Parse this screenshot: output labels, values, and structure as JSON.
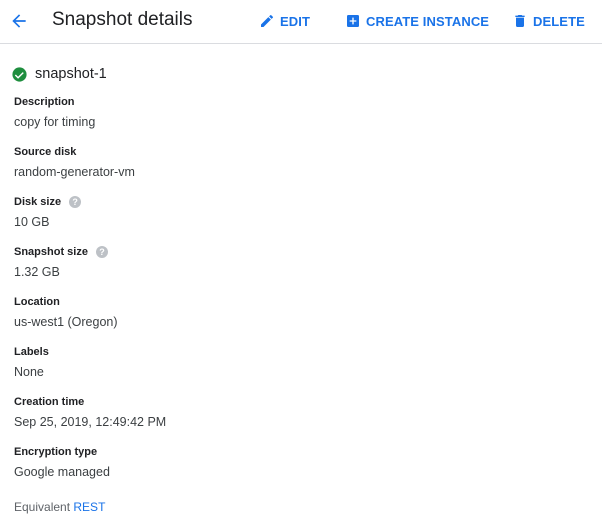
{
  "header": {
    "title": "Snapshot details",
    "actions": [
      {
        "label": "EDIT",
        "icon": "pencil-icon"
      },
      {
        "label": "CREATE INSTANCE",
        "icon": "add-box-icon"
      },
      {
        "label": "DELETE",
        "icon": "trash-icon"
      }
    ]
  },
  "snapshot": {
    "name": "snapshot-1",
    "status_icon": "check-circle-icon",
    "status_color": "#1e8e3e"
  },
  "fields": [
    {
      "label": "Description",
      "value": "copy for timing",
      "help": false
    },
    {
      "label": "Source disk",
      "value": "random-generator-vm",
      "help": false
    },
    {
      "label": "Disk size",
      "value": "10 GB",
      "help": true
    },
    {
      "label": "Snapshot size",
      "value": "1.32 GB",
      "help": true
    },
    {
      "label": "Location",
      "value": "us-west1 (Oregon)",
      "help": false
    },
    {
      "label": "Labels",
      "value": "None",
      "help": false
    },
    {
      "label": "Creation time",
      "value": "Sep 25, 2019, 12:49:42 PM",
      "help": false
    },
    {
      "label": "Encryption type",
      "value": "Google managed",
      "help": false
    }
  ],
  "footer": {
    "equivalent_text": "Equivalent",
    "rest_link": "REST"
  },
  "colors": {
    "accent": "#1a73e8",
    "success": "#1e8e3e",
    "help_icon": "#bdc1c6"
  }
}
